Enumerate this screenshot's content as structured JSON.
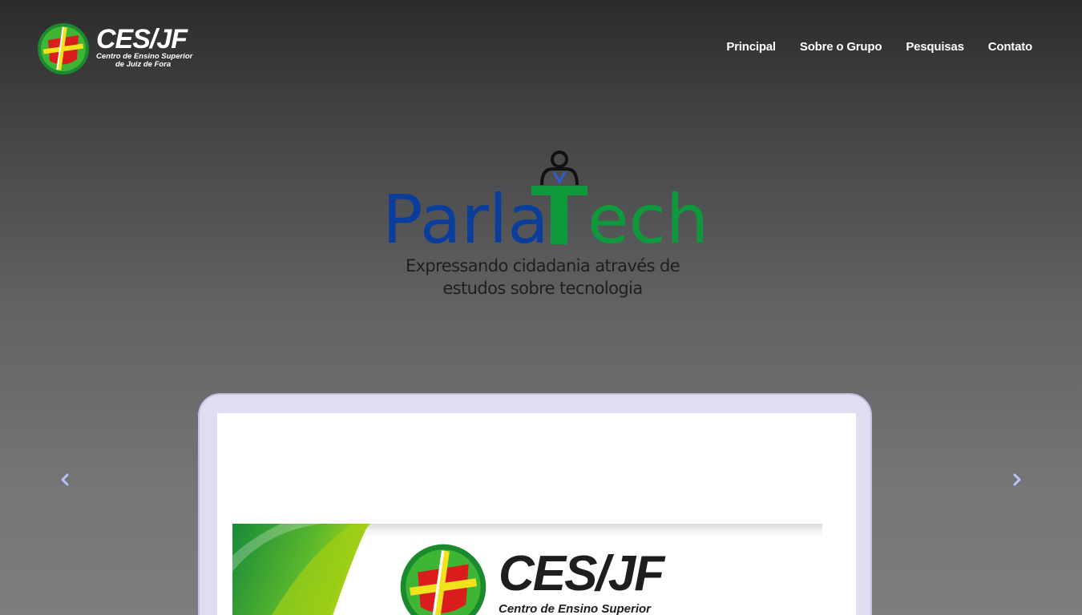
{
  "header": {
    "brand": {
      "name": "CES/JF",
      "subtitle_line1": "Centro de Ensino Superior",
      "subtitle_line2": "de Juiz de Fora",
      "icon": "cesjf-emblem-icon"
    },
    "nav": [
      {
        "label": "Principal"
      },
      {
        "label": "Sobre o Grupo"
      },
      {
        "label": "Pesquisas"
      },
      {
        "label": "Contato"
      }
    ]
  },
  "hero": {
    "logo_text_blue": "Parla",
    "logo_text_green": "Tech",
    "tagline_line1": "Expressando cidadania através de",
    "tagline_line2": "estudos sobre tecnologia",
    "icon": "person-icon"
  },
  "carousel": {
    "prev_icon": "chevron-left-icon",
    "next_icon": "chevron-right-icon",
    "slide": {
      "brand_name": "CES/JF",
      "brand_subtitle": "Centro de Ensino Superior"
    }
  },
  "colors": {
    "parla_blue": "#0a3d9c",
    "tech_green": "#0e9a3c",
    "arrow_color": "#b9c3f5",
    "device_frame": "#e1ddf0"
  }
}
